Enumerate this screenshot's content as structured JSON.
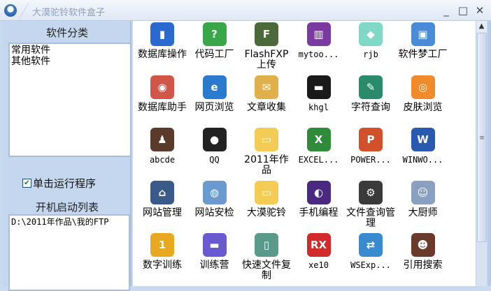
{
  "window": {
    "title": "大漠驼铃软件盒子",
    "minimize": "_",
    "maximize": "□",
    "close": "✕"
  },
  "sidebar": {
    "category_header": "软件分类",
    "categories": [
      "常用软件",
      "其他软件"
    ],
    "checkbox_label": "单击运行程序",
    "checkbox_checked": true,
    "startup_header": "开机启动列表",
    "startup_items": [
      "D:\\2011年作品\\我的FTP"
    ]
  },
  "items": [
    {
      "label": "数据库操作",
      "icon": "chart-icon",
      "color": "#2a6ad0",
      "glyph": "▮"
    },
    {
      "label": "代码工厂",
      "icon": "help-book-icon",
      "color": "#3aa64a",
      "glyph": "?"
    },
    {
      "label": "FlashFXP上传",
      "icon": "flashfxp-icon",
      "color": "#4a6a3a",
      "glyph": "F"
    },
    {
      "label": "mytoo...",
      "icon": "books-icon",
      "color": "#7a3aa0",
      "glyph": "▥"
    },
    {
      "label": "rjb",
      "icon": "folder-icon",
      "color": "#7fd9c6",
      "glyph": "◆"
    },
    {
      "label": "软件梦工厂",
      "icon": "network-icon",
      "color": "#4a8ad6",
      "glyph": "▣"
    },
    {
      "label": "数据库助手",
      "icon": "database-icon",
      "color": "#d0564a",
      "glyph": "◉"
    },
    {
      "label": "网页浏览",
      "icon": "browser-icon",
      "color": "#2a7ad0",
      "glyph": "e"
    },
    {
      "label": "文章收集",
      "icon": "book-icon",
      "color": "#e0b04a",
      "glyph": "✉"
    },
    {
      "label": "khgl",
      "icon": "car-icon",
      "color": "#1a1a1a",
      "glyph": "▬"
    },
    {
      "label": "字符查询",
      "icon": "character-icon",
      "color": "#2a8a6a",
      "glyph": "✎"
    },
    {
      "label": "皮肤浏览",
      "icon": "skin-icon",
      "color": "#f08a2a",
      "glyph": "◎"
    },
    {
      "label": "abcde",
      "icon": "person-icon",
      "color": "#5a3a2a",
      "glyph": "♟"
    },
    {
      "label": "QQ",
      "icon": "qq-icon",
      "color": "#222",
      "glyph": "●"
    },
    {
      "label": "2011年作品",
      "icon": "folder-icon",
      "color": "#f2cc55",
      "glyph": "▭"
    },
    {
      "label": "EXCEL...",
      "icon": "excel-icon",
      "color": "#2f8a3a",
      "glyph": "X"
    },
    {
      "label": "POWER...",
      "icon": "powerpoint-icon",
      "color": "#d2502a",
      "glyph": "P"
    },
    {
      "label": "WINWO...",
      "icon": "word-icon",
      "color": "#2a5ab0",
      "glyph": "W"
    },
    {
      "label": "网站管理",
      "icon": "website-icon",
      "color": "#3a5a8a",
      "glyph": "⌂"
    },
    {
      "label": "网站安检",
      "icon": "globe-icon",
      "color": "#6a9ad0",
      "glyph": "◍"
    },
    {
      "label": "大漠驼铃",
      "icon": "folder-icon",
      "color": "#f2cc55",
      "glyph": "▭"
    },
    {
      "label": "手机编程",
      "icon": "eclipse-icon",
      "color": "#4a2a80",
      "glyph": "◐"
    },
    {
      "label": "文件查询管理",
      "icon": "search-file-icon",
      "color": "#3a3a3a",
      "glyph": "⚙"
    },
    {
      "label": "大厨师",
      "icon": "chef-icon",
      "color": "#8aa0c0",
      "glyph": "☺"
    },
    {
      "label": "数字训练",
      "icon": "medal-icon",
      "color": "#e8a820",
      "glyph": "1"
    },
    {
      "label": "训练营",
      "icon": "car-icon",
      "color": "#6a5ad0",
      "glyph": "▬"
    },
    {
      "label": "快速文件复制",
      "icon": "copy-icon",
      "color": "#5a9a8a",
      "glyph": "▯"
    },
    {
      "label": "xe10",
      "icon": "rx-icon",
      "color": "#d02a2a",
      "glyph": "RX"
    },
    {
      "label": "WSExp...",
      "icon": "network-transfer-icon",
      "color": "#3a8ad0",
      "glyph": "⇄"
    },
    {
      "label": "引用搜索",
      "icon": "portrait-icon",
      "color": "#6a3a2a",
      "glyph": "☻"
    }
  ]
}
